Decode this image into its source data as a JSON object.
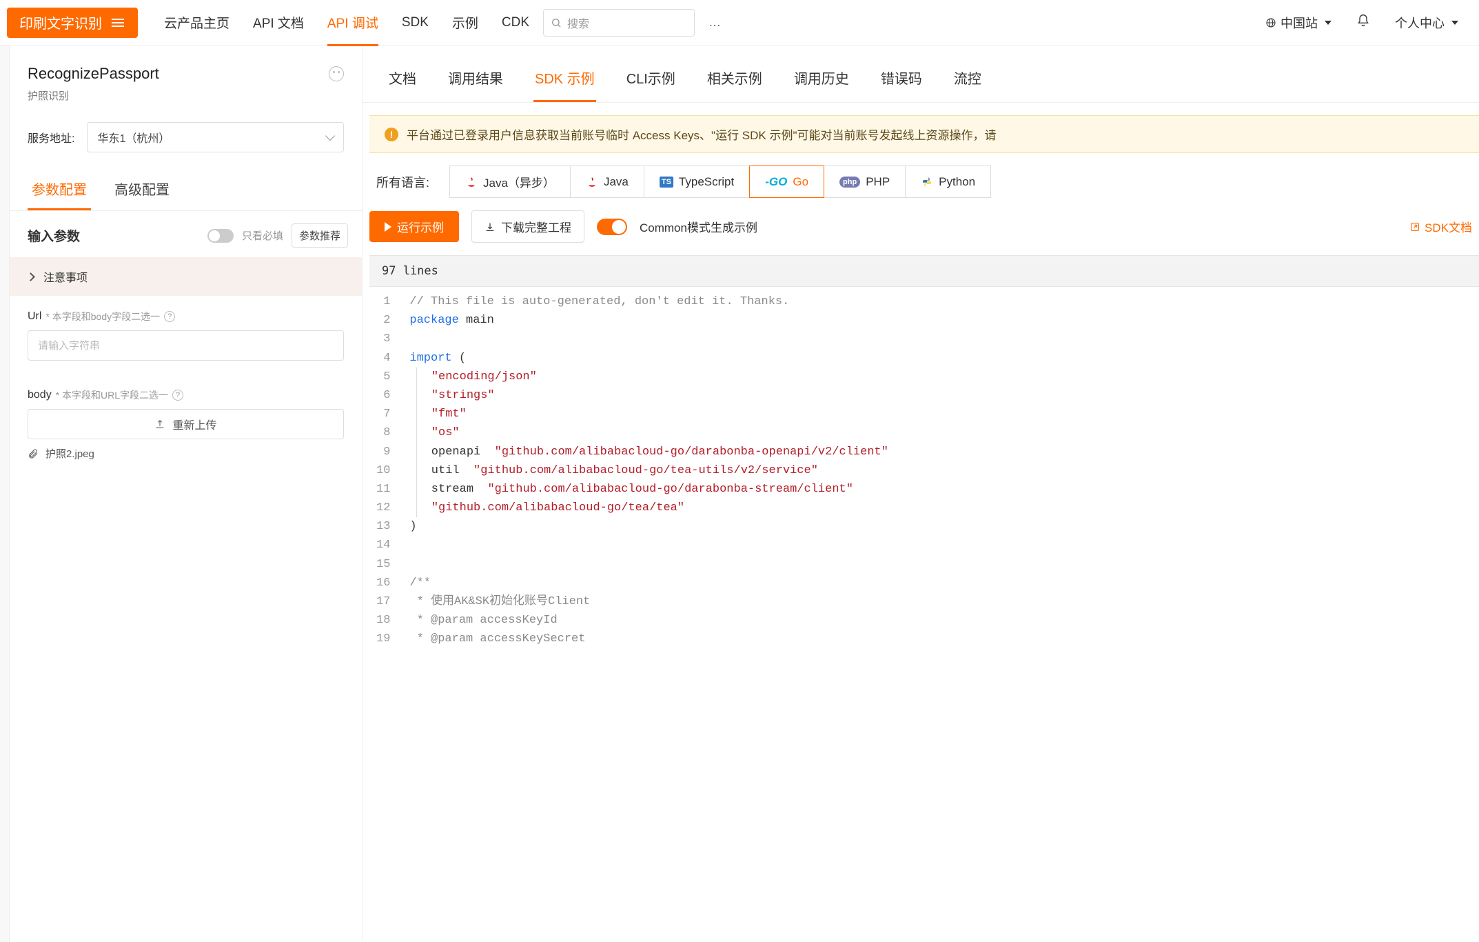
{
  "header": {
    "brand": "印刷文字识别",
    "nav": [
      {
        "label": "云产品主页",
        "active": false
      },
      {
        "label": "API 文档",
        "active": false
      },
      {
        "label": "API 调试",
        "active": true
      },
      {
        "label": "SDK",
        "active": false
      },
      {
        "label": "示例",
        "active": false
      },
      {
        "label": "CDK",
        "active": false
      }
    ],
    "search_placeholder": "搜索",
    "more": "…",
    "region": "中国站",
    "user": "个人中心"
  },
  "left": {
    "api_name": "RecognizePassport",
    "api_desc": "护照识别",
    "service_label": "服务地址:",
    "service_value": "华东1（杭州）",
    "tabs": [
      {
        "label": "参数配置",
        "active": true
      },
      {
        "label": "高级配置",
        "active": false
      }
    ],
    "input_params_title": "输入参数",
    "only_required": "只看必填",
    "param_recommend": "参数推荐",
    "notice": "注意事项",
    "fields": {
      "url": {
        "label": "Url",
        "hint": "* 本字段和body字段二选一",
        "placeholder": "请输入字符串"
      },
      "body": {
        "label": "body",
        "hint": "* 本字段和URL字段二选一",
        "upload": "重新上传",
        "file": "护照2.jpeg"
      }
    }
  },
  "right": {
    "tabs": [
      {
        "label": "文档",
        "active": false
      },
      {
        "label": "调用结果",
        "active": false
      },
      {
        "label": "SDK 示例",
        "active": true
      },
      {
        "label": "CLI示例",
        "active": false
      },
      {
        "label": "相关示例",
        "active": false
      },
      {
        "label": "调用历史",
        "active": false
      },
      {
        "label": "错误码",
        "active": false
      },
      {
        "label": "流控",
        "active": false
      }
    ],
    "warning": "平台通过已登录用户信息获取当前账号临时 Access Keys、\"运行 SDK 示例\"可能对当前账号发起线上资源操作，请",
    "lang_label": "所有语言:",
    "languages": [
      {
        "label": "Java（异步）",
        "active": false,
        "ico": "java"
      },
      {
        "label": "Java",
        "active": false,
        "ico": "java"
      },
      {
        "label": "TypeScript",
        "active": false,
        "ico": "ts"
      },
      {
        "label": "Go",
        "active": false,
        "ico": "go"
      },
      {
        "label": "PHP",
        "active": false,
        "ico": "php"
      },
      {
        "label": "Python",
        "active": false,
        "ico": "py"
      }
    ],
    "active_lang_index": 3,
    "run_label": "运行示例",
    "download_label": "下载完整工程",
    "common_label": "Common模式生成示例",
    "sdk_doc": "SDK文档",
    "code_summary": "97 lines",
    "code": [
      {
        "n": 1,
        "t": [
          [
            "cmt",
            "// This file is auto-generated, don't edit it. Thanks."
          ]
        ]
      },
      {
        "n": 2,
        "t": [
          [
            "kw",
            "package"
          ],
          [
            "id",
            " main"
          ]
        ]
      },
      {
        "n": 3,
        "t": []
      },
      {
        "n": 4,
        "t": [
          [
            "kw",
            "import"
          ],
          [
            "id",
            " ("
          ]
        ]
      },
      {
        "n": 5,
        "t": [
          [
            "id",
            "  "
          ],
          [
            "str",
            "\"encoding/json\""
          ]
        ]
      },
      {
        "n": 6,
        "t": [
          [
            "id",
            "  "
          ],
          [
            "str",
            "\"strings\""
          ]
        ]
      },
      {
        "n": 7,
        "t": [
          [
            "id",
            "  "
          ],
          [
            "str",
            "\"fmt\""
          ]
        ]
      },
      {
        "n": 8,
        "t": [
          [
            "id",
            "  "
          ],
          [
            "str",
            "\"os\""
          ]
        ]
      },
      {
        "n": 9,
        "t": [
          [
            "id",
            "  openapi  "
          ],
          [
            "str",
            "\"github.com/alibabacloud-go/darabonba-openapi/v2/client\""
          ]
        ]
      },
      {
        "n": 10,
        "t": [
          [
            "id",
            "  util  "
          ],
          [
            "str",
            "\"github.com/alibabacloud-go/tea-utils/v2/service\""
          ]
        ]
      },
      {
        "n": 11,
        "t": [
          [
            "id",
            "  stream  "
          ],
          [
            "str",
            "\"github.com/alibabacloud-go/darabonba-stream/client\""
          ]
        ]
      },
      {
        "n": 12,
        "t": [
          [
            "id",
            "  "
          ],
          [
            "str",
            "\"github.com/alibabacloud-go/tea/tea\""
          ]
        ]
      },
      {
        "n": 13,
        "t": [
          [
            "id",
            ")"
          ]
        ]
      },
      {
        "n": 14,
        "t": []
      },
      {
        "n": 15,
        "t": []
      },
      {
        "n": 16,
        "t": [
          [
            "cmt",
            "/**"
          ]
        ]
      },
      {
        "n": 17,
        "t": [
          [
            "cmt",
            " * 使用AK&SK初始化账号Client"
          ]
        ]
      },
      {
        "n": 18,
        "t": [
          [
            "cmt",
            " * @param accessKeyId"
          ]
        ]
      },
      {
        "n": 19,
        "t": [
          [
            "cmt",
            " * @param accessKeySecret"
          ]
        ]
      }
    ]
  }
}
